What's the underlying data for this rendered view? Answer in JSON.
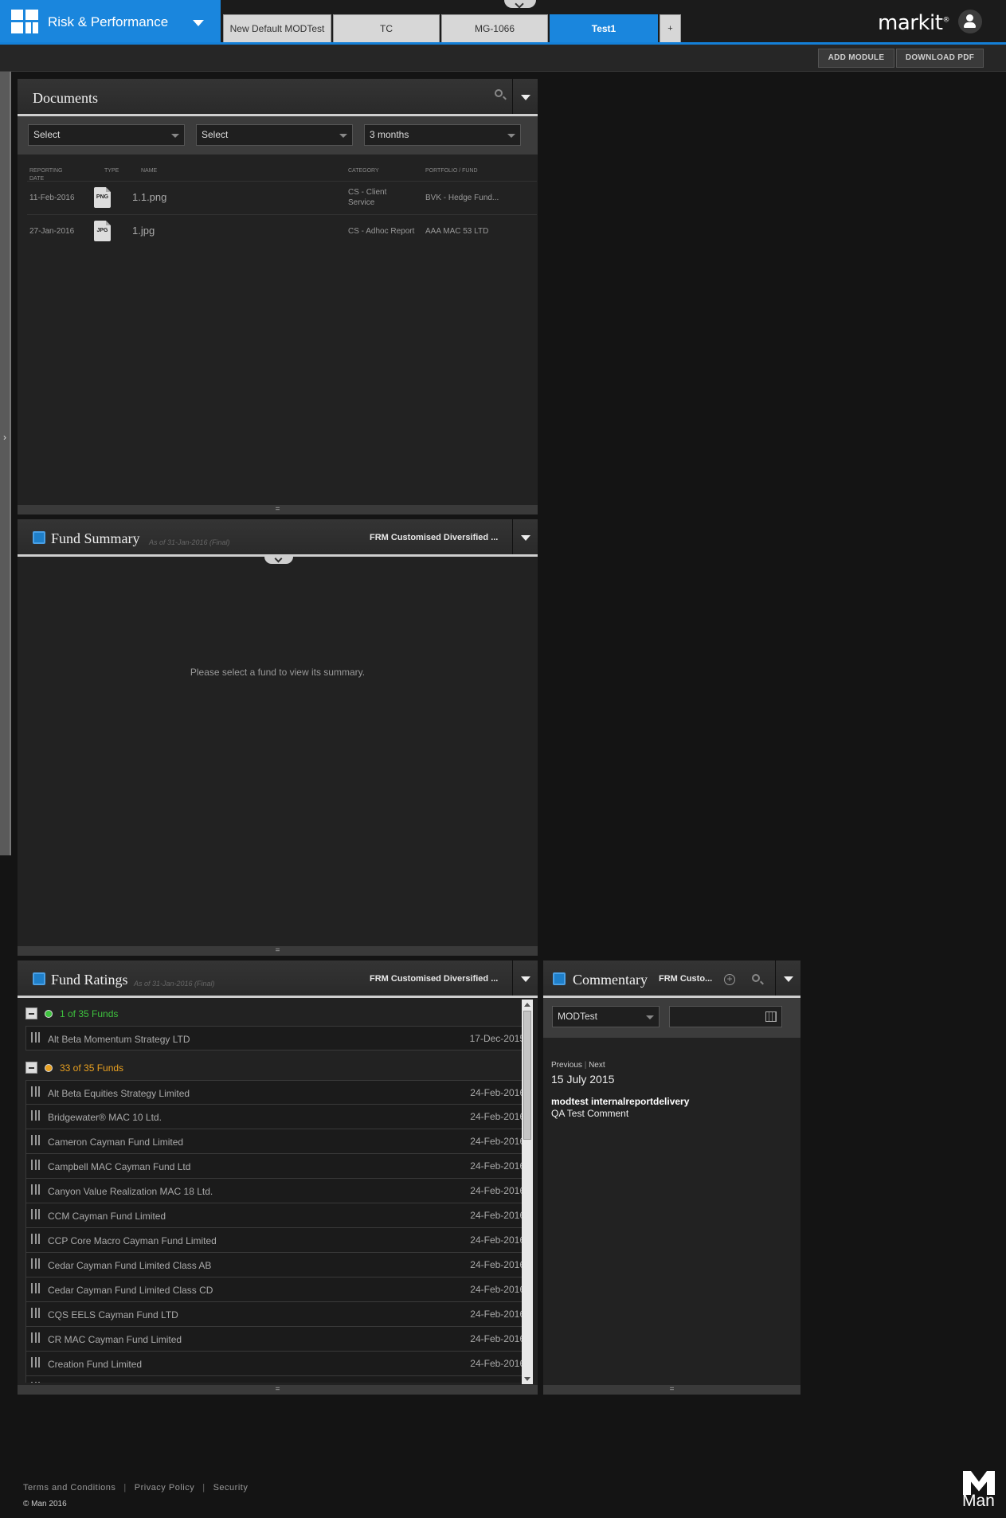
{
  "app": {
    "title": "Risk & Performance"
  },
  "tabs": [
    {
      "label": "New Default MODTest"
    },
    {
      "label": "TC"
    },
    {
      "label": "MG-1066"
    },
    {
      "label": "Test1"
    },
    {
      "label": "+"
    }
  ],
  "brand": {
    "name": "markit"
  },
  "toolbar": {
    "add_module": "ADD MODULE",
    "download_pdf": "DOWNLOAD PDF"
  },
  "documents": {
    "title": "Documents",
    "filters": [
      {
        "value": "Select"
      },
      {
        "value": "Select"
      },
      {
        "value": "3 months"
      }
    ],
    "columns": {
      "reporting_date": "REPORTING DATE",
      "type": "TYPE",
      "name": "NAME",
      "category": "CATEGORY",
      "portfolio": "PORTFOLIO / FUND"
    },
    "rows": [
      {
        "date": "11-Feb-2016",
        "type": "PNG",
        "name": "1.1.png",
        "category": "CS - Client Service",
        "portfolio": "BVK - Hedge Fund..."
      },
      {
        "date": "27-Jan-2016",
        "type": "JPG",
        "name": "1.jpg",
        "category": "CS - Adhoc Report",
        "portfolio": "AAA MAC 53 LTD"
      }
    ]
  },
  "fund_summary": {
    "title": "Fund Summary",
    "as_of": "As of 31-Jan-2016 (Final)",
    "fund": "FRM Customised Diversified ...",
    "empty_message": "Please select a fund to view its summary."
  },
  "fund_ratings": {
    "title": "Fund Ratings",
    "as_of": "As of 31-Jan-2016 (Final)",
    "fund": "FRM Customised Diversified ...",
    "groups": [
      {
        "label": "1 of 35 Funds",
        "color": "#3ec23e",
        "items": [
          {
            "name": "Alt Beta Momentum Strategy LTD",
            "date": "17-Dec-2015"
          }
        ]
      },
      {
        "label": "33 of 35 Funds",
        "color": "#e8a020",
        "items": [
          {
            "name": "Alt Beta Equities Strategy Limited",
            "date": "24-Feb-2016"
          },
          {
            "name": "Bridgewater® MAC 10 Ltd.",
            "date": "24-Feb-2016"
          },
          {
            "name": "Cameron Cayman Fund Limited",
            "date": "24-Feb-2016"
          },
          {
            "name": "Campbell MAC Cayman Fund Ltd",
            "date": "24-Feb-2016"
          },
          {
            "name": "Canyon Value Realization MAC 18 Ltd.",
            "date": "24-Feb-2016"
          },
          {
            "name": "CCM Cayman Fund Limited",
            "date": "24-Feb-2016"
          },
          {
            "name": "CCP Core Macro Cayman Fund Limited",
            "date": "24-Feb-2016"
          },
          {
            "name": "Cedar Cayman Fund Limited Class AB",
            "date": "24-Feb-2016"
          },
          {
            "name": "Cedar Cayman Fund Limited Class CD",
            "date": "24-Feb-2016"
          },
          {
            "name": "CQS EELS Cayman Fund LTD",
            "date": "24-Feb-2016"
          },
          {
            "name": "CR MAC Cayman Fund Limited",
            "date": "24-Feb-2016"
          },
          {
            "name": "Creation Fund Limited",
            "date": "24-Feb-2016"
          }
        ]
      }
    ]
  },
  "commentary": {
    "title": "Commentary",
    "fund": "FRM Custo...",
    "selector": "MODTest",
    "date_input": "",
    "nav": {
      "previous": "Previous",
      "separator": "|",
      "next": "Next"
    },
    "date": "15 July 2015",
    "author": "modtest internalreportdelivery",
    "comment": "QA Test Comment"
  },
  "footer": {
    "links": [
      "Terms and Conditions",
      "Privacy Policy",
      "Security"
    ],
    "copyright": "© Man 2016",
    "logo_text": "Man"
  }
}
